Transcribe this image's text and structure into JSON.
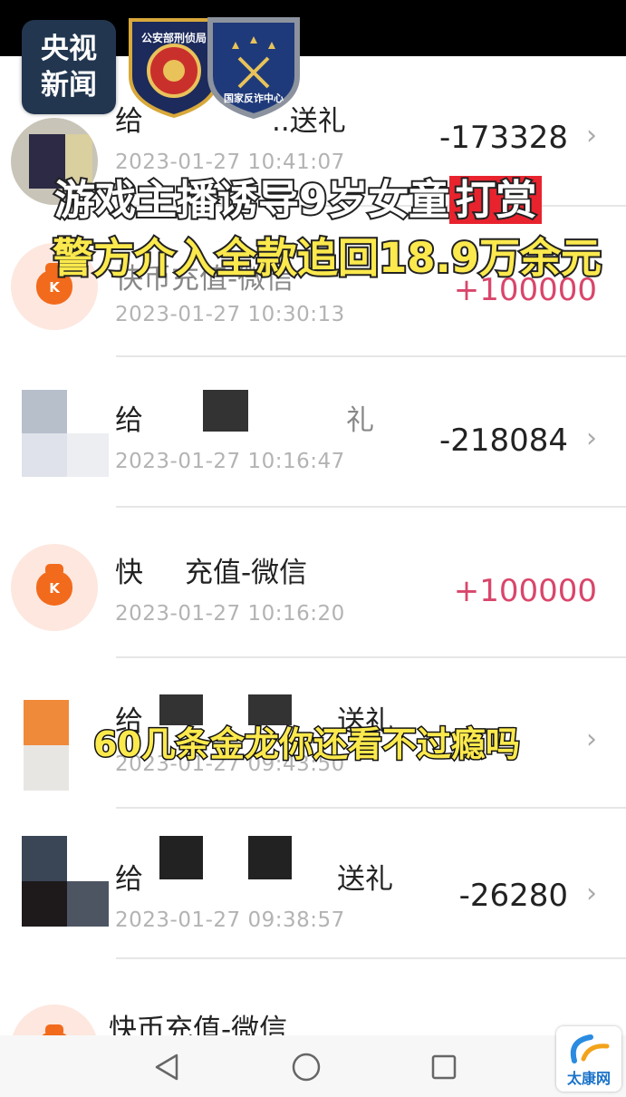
{
  "logos": {
    "cctv_line1": "央视",
    "cctv_line2": "新闻",
    "badge1_text": "公安部刑侦局",
    "badge2_text": "国家反诈中心"
  },
  "headline": {
    "line1_pre": "游戏主播诱导9岁女童",
    "line1_red": "打赏",
    "line2": "警方介入全款追回18.9万余元"
  },
  "subtitle": "60几条金龙你还看不过瘾吗",
  "transactions": [
    {
      "title": "给",
      "title_end": "..送礼",
      "date": "2023-01-27 10:41:07",
      "amount": "-173328"
    },
    {
      "title": "快币充值-微信",
      "date": "2023-01-27 10:30:13",
      "amount": "+100000"
    },
    {
      "title": "给",
      "title_end": "礼",
      "date": "2023-01-27 10:16:47",
      "amount": "-218084"
    },
    {
      "title": "快",
      "title_end": "充值-微信",
      "date": "2023-01-27 10:16:20",
      "amount": "+100000"
    },
    {
      "title": "给",
      "title_end": "送礼",
      "date": "2023-01-27 09:43:50",
      "amount": ""
    },
    {
      "title": "给",
      "title_end": "送礼",
      "date": "2023-01-27 09:38:57",
      "amount": "-26280"
    },
    {
      "title": "快币充值-微信",
      "date": "",
      "amount": ""
    }
  ],
  "watermark": {
    "label": "太康网"
  },
  "icons": {
    "chevron": "›",
    "bag_letter": "K"
  }
}
